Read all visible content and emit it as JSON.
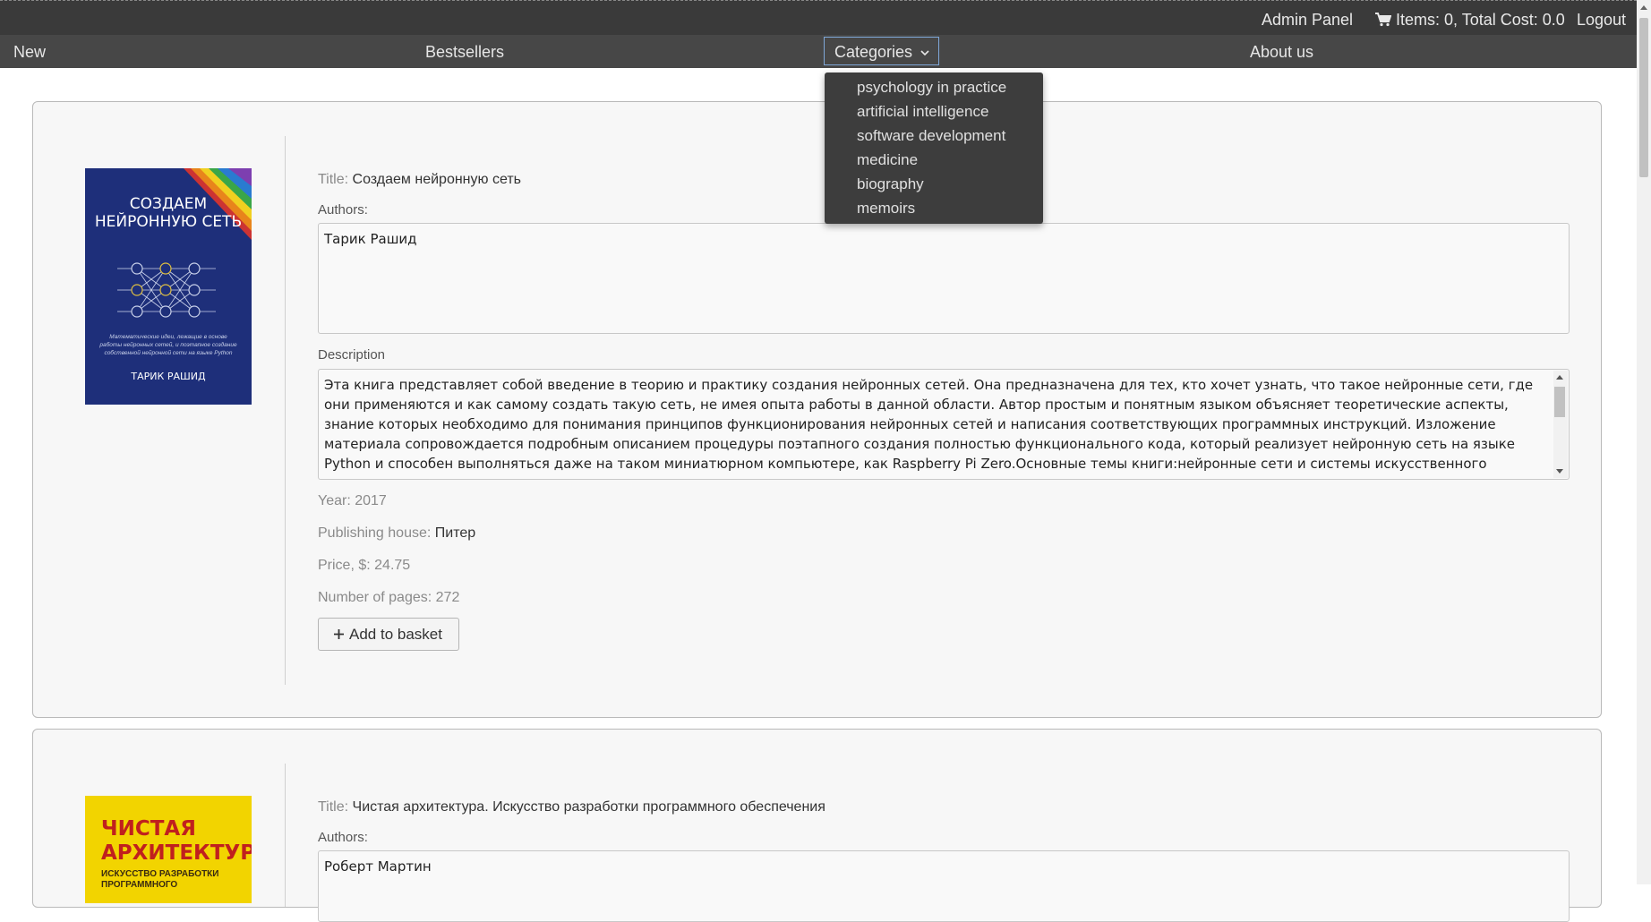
{
  "topbar": {
    "admin_panel": "Admin Panel",
    "cart": "Items: 0, Total Cost: 0.0",
    "logout": "Logout"
  },
  "nav": {
    "new": "New",
    "bestsellers": "Bestsellers",
    "categories": "Categories",
    "about": "About us"
  },
  "categories_menu": [
    "psychology in practice",
    "artificial intelligence",
    "software development",
    "medicine",
    "biography",
    "memoirs"
  ],
  "books": [
    {
      "title_label": "Title:",
      "title": "Создаем нейронную сеть",
      "authors_label": "Authors:",
      "authors": "Тарик Рашид",
      "description_label": "Description",
      "description": "Эта книга представляет собой введение в теорию и практику создания нейронных сетей. Она предназначена для тех, кто хочет узнать, что такое нейронные сети, где они применяются и как самому создать такую сеть, не имея опыта работы в данной области. Автор простым и понятным языком объясняет теоретические аспекты, знание которых необходимо для понимания принципов функционирования нейронных сетей и написания соответствующих программных инструкций. Изложение материала сопровождается подробным описанием процедуры поэтапного создания полностью функционального кода, который реализует нейронную сеть на языке Python и способен выполняться даже на таком миниатюрном компьютере, как Raspberry Pi Zero.Основные темы книги:нейронные сети и системы искусственного интеллекта;",
      "year_label": "Year:",
      "year": "2017",
      "publisher_label": "Publishing house:",
      "publisher": "Питер",
      "price_label": "Price, $:",
      "price": "24.75",
      "pages_label": "Number of pages:",
      "pages": "272",
      "add_button": "Add to basket",
      "cover": {
        "title": "СОЗДАЕМ НЕЙРОННУЮ СЕТЬ",
        "subtitle": "Математические идеи, лежащие в основе работы нейронных сетей, и поэтапное создание собственной нейронной сети на языке Python",
        "author": "ТАРИК РАШИД",
        "color": "#1e2f7a"
      }
    },
    {
      "title_label": "Title:",
      "title": "Чистая архитектура. Искусство разработки программного обеспечения",
      "authors_label": "Authors:",
      "authors": "Роберт Мартин",
      "cover": {
        "title": "ЧИСТАЯ АРХИТЕКТУРА",
        "subtitle": "ИСКУССТВО РАЗРАБОТКИ ПРОГРАММНОГО",
        "color": "#f2d400"
      }
    }
  ]
}
